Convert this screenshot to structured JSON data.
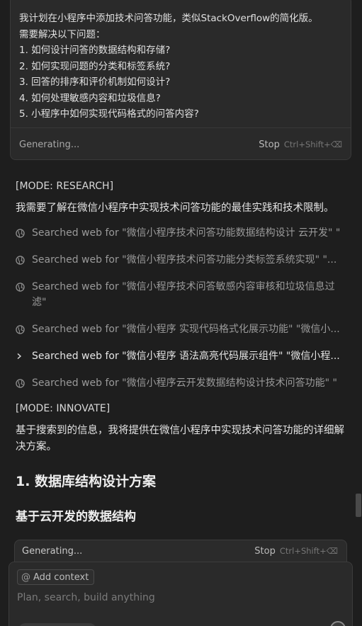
{
  "user_message": {
    "text": "我计划在小程序中添加技术问答功能，类似StackOverflow的简化版。\n需要解决以下问题：\n1. 如何设计问答的数据结构和存储?\n2. 如何实现问题的分类和标签系统?\n3. 回答的排序和评价机制如何设计?\n4. 如何处理敏感内容和垃圾信息?\n5. 小程序中如何实现代码格式的问答内容?"
  },
  "status": {
    "generating": "Generating...",
    "stop": "Stop",
    "stop_shortcut": "Ctrl+Shift+⌫"
  },
  "assistant": {
    "mode_research": "[MODE: RESEARCH]",
    "research_intro": "我需要了解在微信小程序中实现技术问答功能的最佳实践和技术限制。",
    "searches": [
      {
        "text": "Searched web for \"微信小程序技术问答功能数据结构设计 云开发\" \"",
        "icon": "globe-icon"
      },
      {
        "text": "Searched web for \"微信小程序技术问答功能分类标签系统实现\" \"...",
        "icon": "globe-icon"
      },
      {
        "text": "Searched web for \"微信小程序技术问答敏感内容审核和垃圾信息过滤\"",
        "icon": "globe-icon"
      },
      {
        "text": "Searched web for \"微信小程序 实现代码格式化展示功能\" \"微信小...",
        "icon": "globe-icon"
      },
      {
        "text": "Searched web for \"微信小程序 语法高亮代码展示组件\" \"微信小程...",
        "icon": "chevron-right-icon"
      },
      {
        "text": "Searched web for \"微信小程序云开发数据结构设计技术问答功能\" \"",
        "icon": "globe-icon"
      }
    ],
    "mode_innovate": "[MODE: INNOVATE]",
    "innovate_intro": "基于搜索到的信息，我将提供在微信小程序中实现技术问答功能的详细解决方案。",
    "heading_1": "1. 数据库结构设计方案",
    "heading_2": "基于云开发的数据结构"
  },
  "composer": {
    "add_context": "Add context",
    "at_symbol": "@",
    "placeholder": "Plan, search, build anything"
  }
}
